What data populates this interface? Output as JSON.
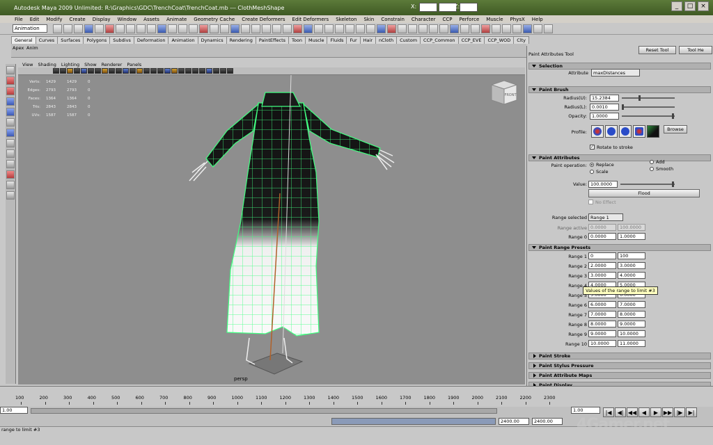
{
  "window": {
    "title": "Autodesk Maya 2009 Unlimited: R:\\Graphics\\GDC\\TrenchCoat\\TrenchCoat.mb  ---  ClothMeshShape",
    "coord_x": "X:",
    "coord_y": "Y:",
    "coord_z": "Z:"
  },
  "menu": [
    "File",
    "Edit",
    "Modify",
    "Create",
    "Display",
    "Window",
    "Assets",
    "Animate",
    "Geometry Cache",
    "Create Deformers",
    "Edit Deformers",
    "Skeleton",
    "Skin",
    "Constrain",
    "Character",
    "CCP",
    "Perforce",
    "Muscle",
    "PhysX",
    "Help"
  ],
  "status": {
    "mode": "Animation"
  },
  "shelf_tabs": [
    "General",
    "Curves",
    "Surfaces",
    "Polygons",
    "Subdivs",
    "Deformation",
    "Animation",
    "Dynamics",
    "Rendering",
    "PaintEffects",
    "Toon",
    "Muscle",
    "Fluids",
    "Fur",
    "Hair",
    "nCloth",
    "Custom",
    "CCP_Common",
    "CCP_EVE",
    "CCP_WOD",
    "Clty"
  ],
  "shelf_labels": [
    "Apex",
    "Anim"
  ],
  "viewport": {
    "menu": [
      "View",
      "Shading",
      "Lighting",
      "Show",
      "Renderer",
      "Panels"
    ],
    "hud": [
      {
        "k": "Verts:",
        "a": "1429",
        "b": "1429",
        "c": "0"
      },
      {
        "k": "Edges:",
        "a": "2793",
        "b": "2793",
        "c": "0"
      },
      {
        "k": "Faces:",
        "a": "1364",
        "b": "1364",
        "c": "0"
      },
      {
        "k": "Tris:",
        "a": "2843",
        "b": "2843",
        "c": "0"
      },
      {
        "k": "UVs:",
        "a": "1587",
        "b": "1587",
        "c": "0"
      }
    ],
    "camera_label": "persp",
    "view_cube_label": "FRONT"
  },
  "panel": {
    "title": "Paint Attributes Tool",
    "reset_tool": "Reset Tool",
    "tool_help": "Tool He",
    "selection": {
      "header": "Selection",
      "attribute_label": "Attribute",
      "attribute_value": "maxDistances"
    },
    "paint_brush": {
      "header": "Paint Brush",
      "radius_u_label": "Radius(U):",
      "radius_u": "15.2384",
      "radius_l_label": "Radius(L):",
      "radius_l": "0.0010",
      "opacity_label": "Opacity:",
      "opacity": "1.0000",
      "profile_label": "Profile:",
      "browse": "Browse",
      "rotate_label": "Rotate to stroke"
    },
    "paint_attributes": {
      "header": "Paint Attributes",
      "operation_label": "Paint operation:",
      "replace": "Replace",
      "add": "Add",
      "scale": "Scale",
      "smooth": "Smooth",
      "value_label": "Value:",
      "value": "100.0000",
      "flood": "Flood",
      "no_effect": "No Effect",
      "range_selected_label": "Range selected",
      "range_selected": "Range 1",
      "range_active_label": "Range active",
      "range_active_a": "0.0000",
      "range_active_b": "100.0000",
      "range0_label": "Range 0",
      "range0_a": "0.0000",
      "range0_b": "1.0000"
    },
    "presets": {
      "header": "Paint Range Presets",
      "rows": [
        {
          "label": "Range 1",
          "a": "0",
          "b": "100"
        },
        {
          "label": "Range 2",
          "a": "2.0000",
          "b": "3.0000"
        },
        {
          "label": "Range 3",
          "a": "3.0000",
          "b": "4.0000"
        },
        {
          "label": "Range 4",
          "a": "4.0000",
          "b": "5.0000"
        },
        {
          "label": "Range 5",
          "a": "5.0000",
          "b": "6.0000"
        },
        {
          "label": "Range 6",
          "a": "6.0000",
          "b": "7.0000"
        },
        {
          "label": "Range 7",
          "a": "7.0000",
          "b": "8.0000"
        },
        {
          "label": "Range 8",
          "a": "8.0000",
          "b": "9.0000"
        },
        {
          "label": "Range 9",
          "a": "9.0000",
          "b": "10.0000"
        },
        {
          "label": "Range 10",
          "a": "10.0000",
          "b": "11.0000"
        }
      ],
      "tooltip": "Values of the range to limit #3"
    },
    "closed_sections": [
      "Paint Stroke",
      "Paint Stylus Pressure",
      "Paint Attribute Maps",
      "Paint Display"
    ]
  },
  "timeline": {
    "ticks": [
      "100",
      "200",
      "300",
      "400",
      "500",
      "600",
      "700",
      "800",
      "900",
      "1000",
      "1100",
      "1200",
      "1300",
      "1400",
      "1500",
      "1600",
      "1700",
      "1800",
      "1900",
      "2000",
      "2100",
      "2200",
      "2300"
    ],
    "start": "1.00",
    "current": "1.00",
    "end_a": "2400.00",
    "end_b": "2400.00"
  },
  "help_line": "range to limit #3",
  "watermark": "4Gamer.net",
  "colors": {
    "mesh_wire": "#40ff80",
    "title_bar": "#4f6b2f",
    "viewport_bg": "#8e8e8e"
  }
}
